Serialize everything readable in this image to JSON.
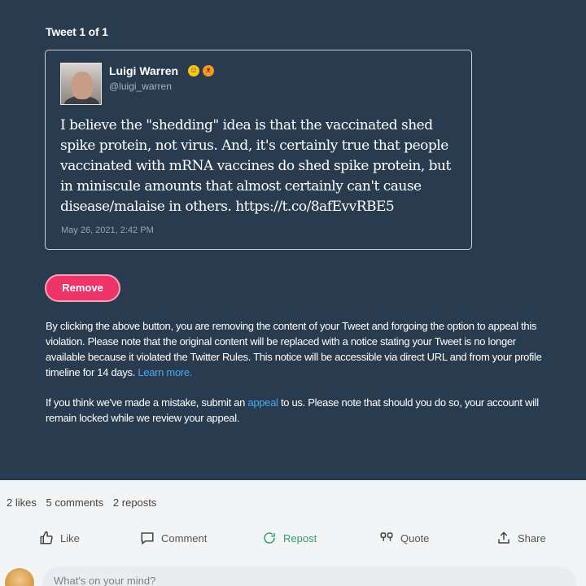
{
  "notice_panel": {
    "tweet_counter": "Tweet 1 of 1",
    "tweet": {
      "author_name": "Luigi Warren",
      "emojis": [
        "smile-emoji",
        "cat-emoji"
      ],
      "author_handle": "@luigi_warren",
      "text": "I believe the \"shedding\" idea is that the vaccinated shed spike protein, not virus. And, it's certainly true that people vaccinated with mRNA vaccines do shed spike protein, but in miniscule amounts that almost certainly can't cause disease/malaise in others. https://t.co/8afEvvRBE5",
      "date": "May 26, 2021, 2:42 PM"
    },
    "remove_label": "Remove",
    "notice_text": "By clicking the above button, you are removing the content of your Tweet and forgoing the option to appeal this violation. Please note that the original content will be replaced with a notice stating your Tweet is no longer available because it violated the Twitter Rules. This notice will be accessible via direct URL and from your profile timeline for 14 days.",
    "learn_more": "Learn more.",
    "appeal_pre": "If you think we've made a mistake, submit an",
    "appeal_link": "appeal",
    "appeal_post": "to us. Please note that should you do so, your account will remain locked while we review your appeal.",
    "colors": {
      "panel": "#283b4f",
      "remove": "#ef3469",
      "link": "#4ba8f0"
    }
  },
  "post_footer": {
    "likes": "2 likes",
    "comments": "5 comments",
    "reposts": "2 reposts",
    "actions": {
      "like": "Like",
      "comment": "Comment",
      "repost": "Repost",
      "quote": "Quote",
      "share": "Share"
    },
    "compose_placeholder": "What's on your mind?"
  }
}
